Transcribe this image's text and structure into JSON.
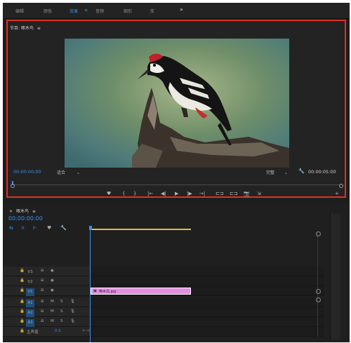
{
  "workspace_tabs": [
    "编辑",
    "颜色",
    "效果",
    "音频",
    "图形",
    "库"
  ],
  "workspace_active_index": 2,
  "workspace_more": "»",
  "program_monitor": {
    "title": "节目: 啄木鸟",
    "menu_glyph": "≡",
    "current_time": "00:00:00:00",
    "fit_dropdown": "适合",
    "quality_dropdown": "完整",
    "duration": "00:00:05:00",
    "wrench_icon": "🔧"
  },
  "transport_controls": [
    "♥",
    "{",
    "}",
    "|←",
    "◀|",
    "▶",
    "|▶",
    "→|",
    "⊏⊐",
    "⊏⊐",
    "📷",
    "⇲",
    "+"
  ],
  "timeline": {
    "title": "啄木鸟",
    "menu_glyph": "≡",
    "close_glyph": "×",
    "current_time": "00:00:00:00",
    "tools": [
      "⇆",
      "∩",
      "⊩",
      "♥",
      "🔧"
    ],
    "video_tracks": [
      {
        "label": "V3",
        "active": false
      },
      {
        "label": "V2",
        "active": false
      },
      {
        "label": "V1",
        "active": true
      }
    ],
    "audio_tracks": [
      {
        "label": "A1",
        "active": true,
        "m": "M",
        "s": "S"
      },
      {
        "label": "A2",
        "active": true,
        "m": "M",
        "s": "S"
      },
      {
        "label": "A3",
        "active": true,
        "m": "M",
        "s": "S"
      }
    ],
    "master_label": "主声道",
    "master_value": "0.0",
    "clip_label": "啄木鸟.jpg"
  },
  "colors": {
    "accent_blue": "#3b8ff0",
    "highlight_red": "#e3311e",
    "clip_pink": "#e48ee0",
    "inout_yellow": "#d8c23a"
  }
}
